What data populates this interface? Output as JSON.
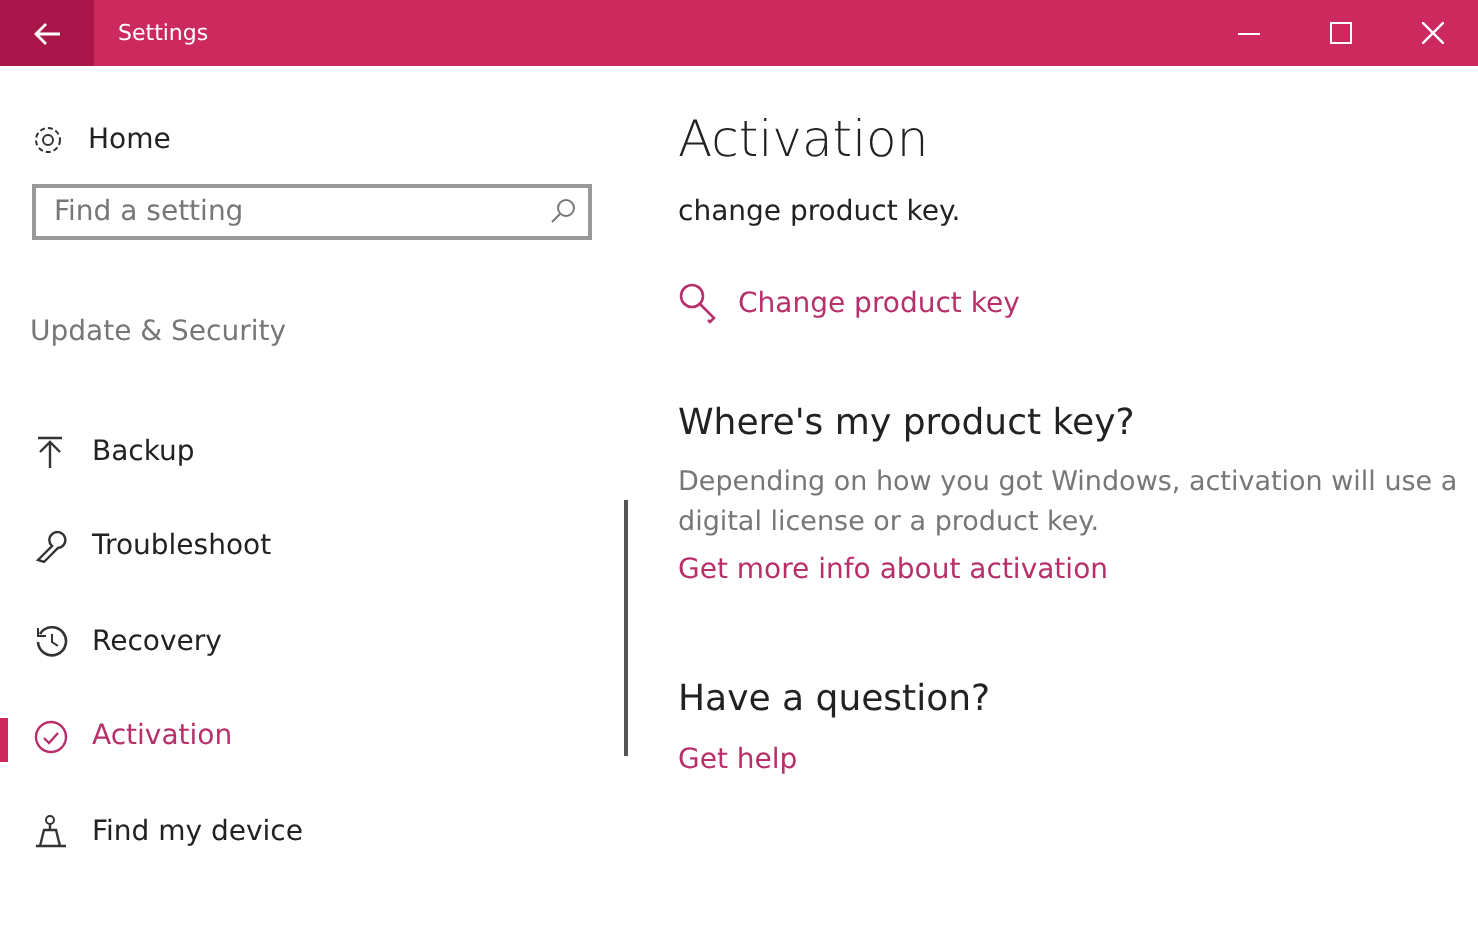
{
  "window": {
    "title": "Settings"
  },
  "sidebar": {
    "home": "Home",
    "search": {
      "placeholder": "Find a setting"
    },
    "section": "Update & Security",
    "items": [
      {
        "label": "Backup",
        "kind": "backup",
        "selected": false
      },
      {
        "label": "Troubleshoot",
        "kind": "troubleshoot",
        "selected": false
      },
      {
        "label": "Recovery",
        "kind": "recovery",
        "selected": false
      },
      {
        "label": "Activation",
        "kind": "activation",
        "selected": true
      },
      {
        "label": "Find my device",
        "kind": "find",
        "selected": false
      }
    ]
  },
  "content": {
    "title": "Activation",
    "text": "change product key.",
    "key_link": "Change product key",
    "sections": [
      {
        "heading": "Where's my product key?",
        "description": "Depending on how you got Windows, activation will use a digital license or a product key.",
        "link": "Get more info about activation"
      },
      {
        "heading": "Have a question?",
        "link": "Get help"
      }
    ]
  }
}
